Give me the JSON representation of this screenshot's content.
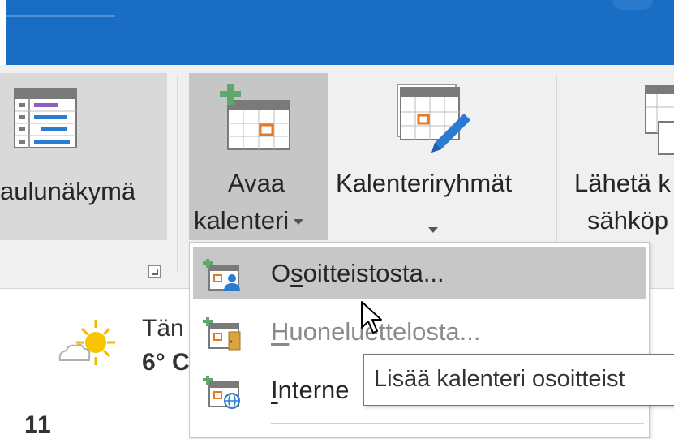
{
  "ribbon": {
    "table_view_label": "aulunäkymä",
    "open_calendar_label_line1": "Avaa",
    "open_calendar_label_line2": "kalenteri",
    "calendar_groups_label": "Kalenteriryhmät",
    "send_label_line1": "Lähetä k",
    "send_label_line2": "sähköp"
  },
  "weather": {
    "today_label": "Tän",
    "temperature": "6° C",
    "partial_number": "11"
  },
  "open_calendar_menu": {
    "items": [
      {
        "prefix": "O",
        "mnemonic": "s",
        "rest": "oitteistosta...",
        "enabled": true,
        "hovered": true,
        "icon": "address-book-calendar-icon"
      },
      {
        "prefix": "",
        "mnemonic": "H",
        "rest": "uoneluettelosta...",
        "enabled": false,
        "hovered": false,
        "icon": "room-list-calendar-icon"
      },
      {
        "prefix": "",
        "mnemonic": "I",
        "rest": "nterne",
        "enabled": true,
        "hovered": false,
        "icon": "internet-calendar-icon"
      }
    ]
  },
  "tooltip": {
    "text": "Lisää kalenteri osoitteist"
  },
  "colors": {
    "title_bar": "#1a6dc4",
    "ribbon_bg": "#f0f0f0",
    "selected_button": "#c6c6c6",
    "hover_item": "#c7c7c7",
    "calendar_green": "#5ea86c",
    "calendar_orange": "#e87722",
    "pencil_blue": "#2b7bd3"
  }
}
